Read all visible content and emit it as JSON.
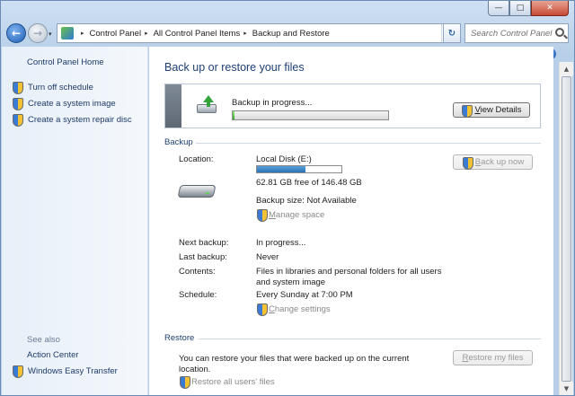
{
  "window": {
    "min_glyph": "—",
    "max_glyph": "□",
    "close_glyph": "✕"
  },
  "nav": {
    "back_glyph": "←",
    "forward_glyph": "→",
    "recent_glyph": "▾",
    "breadcrumbs": [
      "Control Panel",
      "All Control Panel Items",
      "Backup and Restore"
    ],
    "crumb_separator": "▸",
    "address_dropdown_glyph": "▾",
    "refresh_glyph": "↻",
    "search_placeholder": "Search Control Panel"
  },
  "sidebar": {
    "home": "Control Panel Home",
    "items": [
      {
        "label": "Turn off schedule",
        "icon": "uac-shield-icon"
      },
      {
        "label": "Create a system image",
        "icon": "uac-shield-icon"
      },
      {
        "label": "Create a system repair disc",
        "icon": "uac-shield-icon"
      }
    ],
    "see_also_heading": "See also",
    "see_also": [
      {
        "label": "Action Center",
        "icon": null
      },
      {
        "label": "Windows Easy Transfer",
        "icon": "uac-shield-icon"
      }
    ]
  },
  "main": {
    "help_glyph": "?",
    "title": "Back up or restore your files",
    "progress": {
      "label": "Backup in progress...",
      "percent": 1,
      "view_details": "View Details"
    },
    "backup": {
      "heading": "Backup",
      "location_label": "Location:",
      "location_value": "Local Disk (E:)",
      "disk_used_fraction": 0.57,
      "free_space": "62.81 GB free of 146.48 GB",
      "backup_size": "Backup size: Not Available",
      "manage_space": "Manage space",
      "back_up_now": "Back up now",
      "next_backup_label": "Next backup:",
      "next_backup_value": "In progress...",
      "last_backup_label": "Last backup:",
      "last_backup_value": "Never",
      "contents_label": "Contents:",
      "contents_value_line1": "Files in libraries and personal folders for all users",
      "contents_value_line2": "and system image",
      "schedule_label": "Schedule:",
      "schedule_value": "Every Sunday at 7:00 PM",
      "change_settings": "Change settings"
    },
    "restore": {
      "heading": "Restore",
      "description_line1": "You can restore your files that were backed up on the current",
      "description_line2": "location.",
      "restore_my_files": "Restore my files",
      "restore_all_users": "Restore all users' files"
    }
  },
  "scrollbar": {
    "up_glyph": "▲",
    "down_glyph": "▼"
  },
  "colors": {
    "accent_title": "#1e3f73",
    "progress_green": "#2eaa27",
    "disk_blue": "#2a72b6",
    "close_red": "#c54a35"
  }
}
